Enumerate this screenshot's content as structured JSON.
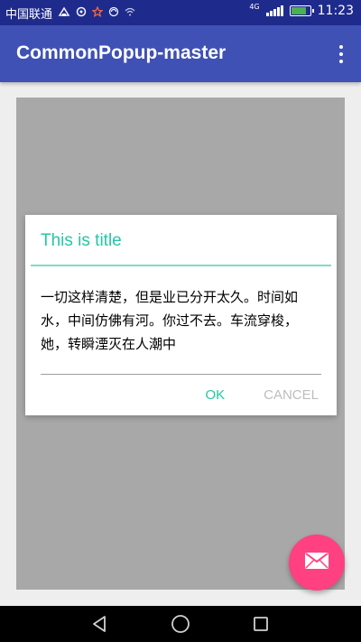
{
  "status_bar": {
    "carrier": "中国联通",
    "network_type": "4G",
    "time": "11:23",
    "battery_level": 0.85,
    "left_icons": [
      "usb-icon",
      "alarm-icon",
      "star-icon",
      "sync-icon",
      "wifi-icon"
    ]
  },
  "app_bar": {
    "title": "CommonPopup-master",
    "menu_icon": "overflow-menu-icon"
  },
  "dialog": {
    "title": "This is title",
    "message": "一切这样清楚，但是业已分开太久。时间如水，中间仿佛有河。你过不去。车流穿梭，她，转瞬湮灭在人潮中",
    "ok_label": "OK",
    "cancel_label": "CANCEL"
  },
  "fab": {
    "icon": "email-icon"
  },
  "nav_bar": {
    "icons": [
      "back-icon",
      "home-icon",
      "recents-icon"
    ]
  },
  "colors": {
    "status_bar": "#1f2b8c",
    "app_bar": "#3f51b5",
    "accent": "#26c6a2",
    "fab": "#ff4081",
    "panel": "#a8a8a8"
  }
}
